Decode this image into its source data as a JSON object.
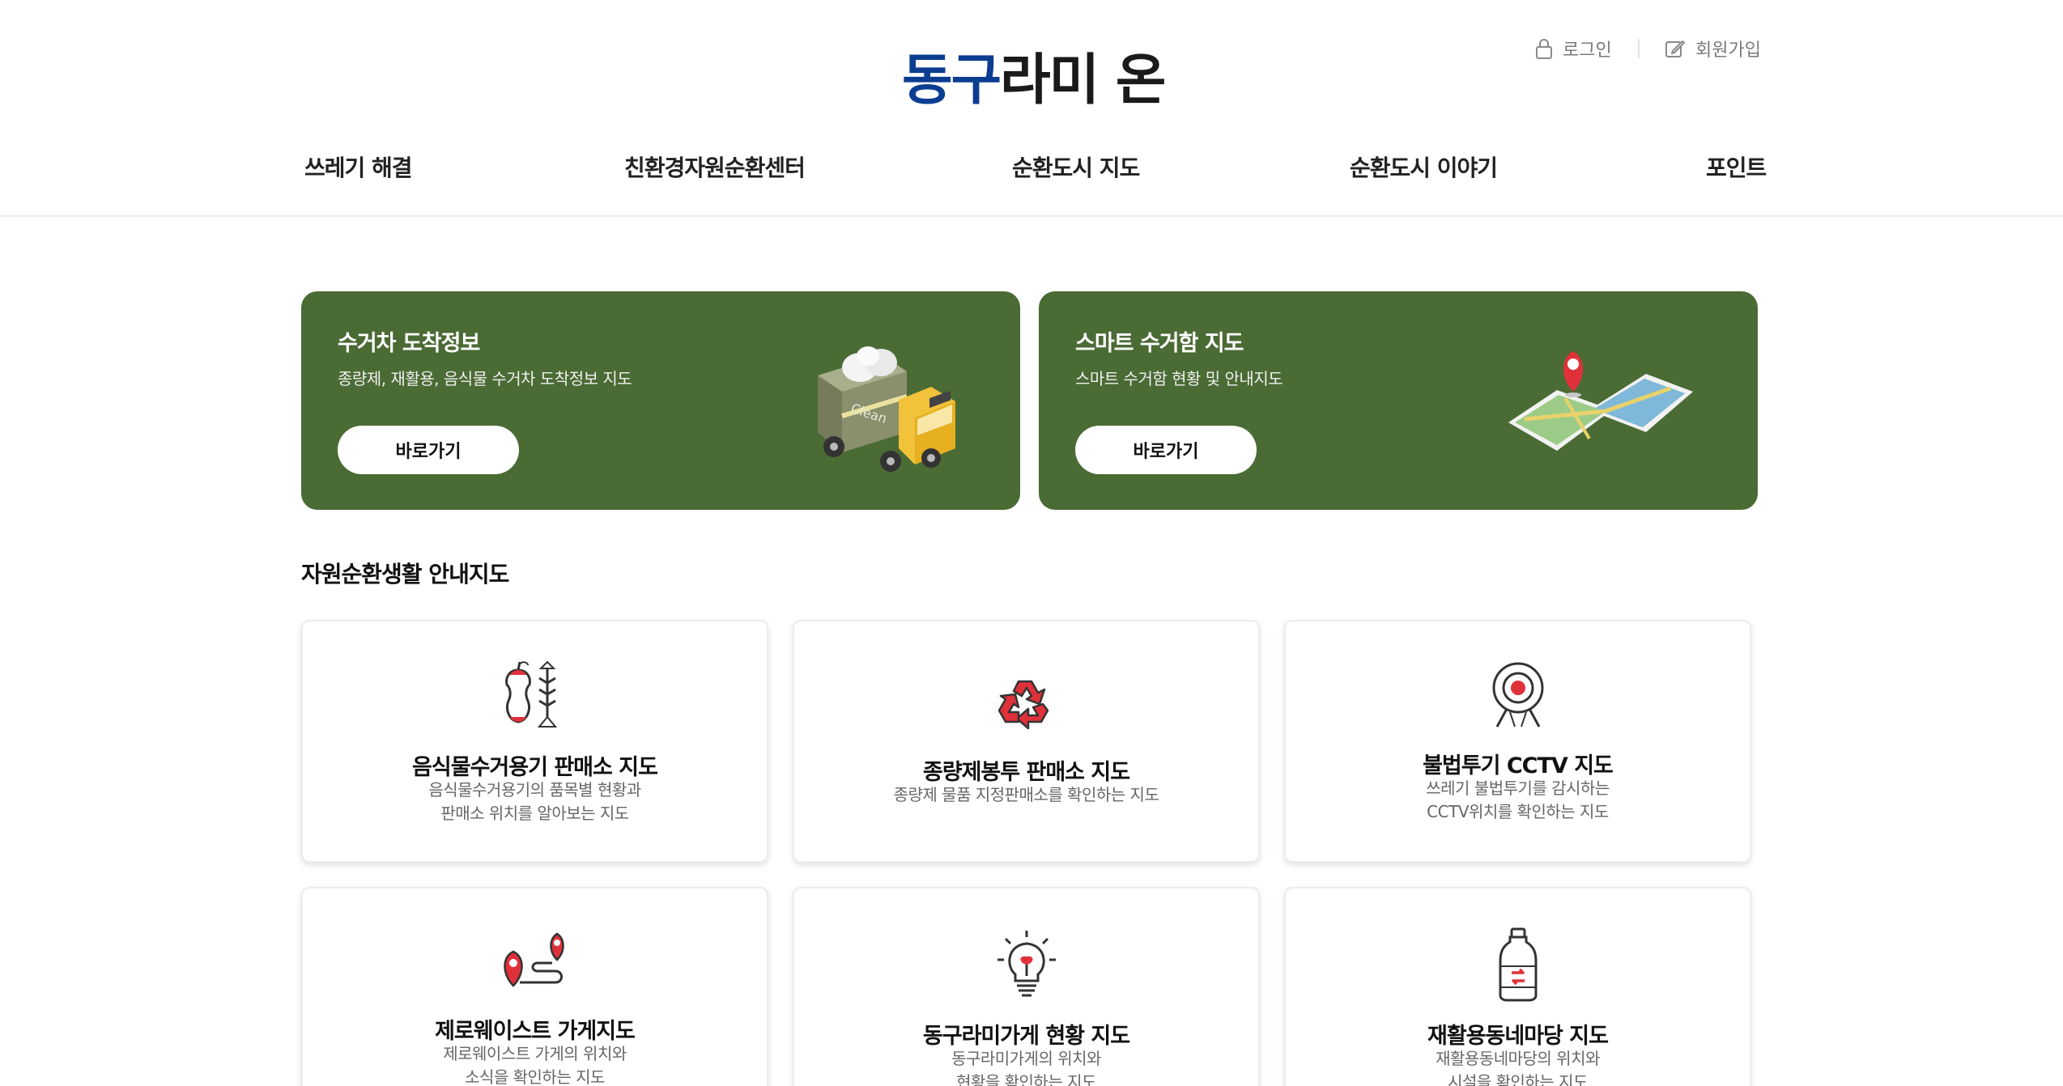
{
  "header": {
    "logo_part1": "동구",
    "logo_part2": "라미 온",
    "login_label": "로그인",
    "join_label": "회원가입"
  },
  "nav": {
    "items": [
      {
        "label": "쓰레기 해결"
      },
      {
        "label": "친환경자원순환센터"
      },
      {
        "label": "순환도시 지도"
      },
      {
        "label": "순환도시 이야기"
      },
      {
        "label": "포인트"
      }
    ]
  },
  "banners": [
    {
      "title": "수거차 도착정보",
      "desc": "종량제, 재활용, 음식물 수거차 도착정보 지도",
      "button": "바로가기",
      "icon": "garbage-truck-icon"
    },
    {
      "title": "스마트 수거함 지도",
      "desc": "스마트 수거함 현황 및 안내지도",
      "button": "바로가기",
      "icon": "map-pin-icon"
    }
  ],
  "section": {
    "title": "자원순환생활 안내지도"
  },
  "cards": [
    {
      "title": "음식물수거용기 판매소 지도",
      "desc1": "음식물수거용기의 품목별 현황과",
      "desc2": "판매소 위치를 알아보는 지도",
      "icon": "food-waste-icon"
    },
    {
      "title": "종량제봉투 판매소 지도",
      "desc1": "종량제 물품 지정판매소를 확인하는 지도",
      "desc2": "",
      "icon": "recycle-icon"
    },
    {
      "title": "불법투기 CCTV 지도",
      "desc1": "쓰레기 불법투기를 감시하는",
      "desc2": "CCTV위치를 확인하는 지도",
      "icon": "cctv-icon"
    },
    {
      "title": "제로웨이스트 가게지도",
      "desc1": "제로웨이스트 가게의 위치와",
      "desc2": "소식을 확인하는 지도",
      "icon": "route-pin-icon"
    },
    {
      "title": "동구라미가게 현황 지도",
      "desc1": "동구라미가게의 위치와",
      "desc2": "현황을 확인하는 지도",
      "icon": "lightbulb-icon"
    },
    {
      "title": "재활용동네마당 지도",
      "desc1": "재활용동네마당의 위치와",
      "desc2": "시설을 확인하는 지도",
      "icon": "bottle-icon"
    }
  ],
  "colors": {
    "brand_blue": "#0b3d91",
    "banner_green": "#4a6b34",
    "accent_red": "#e0313a"
  }
}
